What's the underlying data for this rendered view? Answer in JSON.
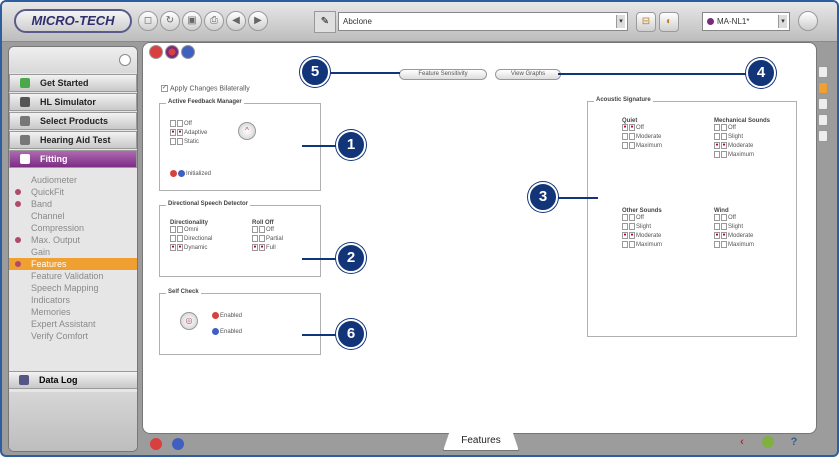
{
  "app": {
    "logo_text": "MICRO-TECH",
    "patient_name": "Abclone",
    "session": "MA-NL1*"
  },
  "sidebar": {
    "nav": [
      {
        "label": "Get Started",
        "icon": "green-check-icon",
        "color": "#4aa84a"
      },
      {
        "label": "HL Simulator",
        "icon": "pencil-icon",
        "color": "#555555"
      },
      {
        "label": "Select Products",
        "icon": "products-icon",
        "color": "#777777"
      },
      {
        "label": "Hearing Aid Test",
        "icon": "test-icon",
        "color": "#777777"
      },
      {
        "label": "Fitting",
        "icon": "fitting-icon",
        "color": "#ffffff"
      }
    ],
    "sub_items": [
      {
        "label": "Audiometer",
        "bullet": false
      },
      {
        "label": "QuickFit",
        "bullet": true
      },
      {
        "label": "Band",
        "bullet": true
      },
      {
        "label": "Channel",
        "bullet": false
      },
      {
        "label": "Compression",
        "bullet": false
      },
      {
        "label": "Max. Output",
        "bullet": true
      },
      {
        "label": "Gain",
        "bullet": false
      },
      {
        "label": "Features",
        "bullet": true,
        "selected": true
      },
      {
        "label": "Feature Validation",
        "bullet": false
      },
      {
        "label": "Speech Mapping",
        "bullet": false
      },
      {
        "label": "Indicators",
        "bullet": false
      },
      {
        "label": "Memories",
        "bullet": false
      },
      {
        "label": "Expert Assistant",
        "bullet": false
      },
      {
        "label": "Verify Comfort",
        "bullet": false
      }
    ],
    "data_log": "Data Log"
  },
  "main": {
    "feature_sensitivity": "Feature Sensitivity",
    "view_graphs": "View Graphs",
    "apply_bilaterally": "Apply Changes Bilaterally",
    "afm": {
      "title": "Active Feedback Manager",
      "options": [
        "Off",
        "Adaptive",
        "Static"
      ],
      "initialized": "Initialized"
    },
    "dsd": {
      "title": "Directional Speech Detector",
      "directionality_head": "Directionality",
      "directionality": [
        "Omni",
        "Directional",
        "Dynamic"
      ],
      "rolloff_head": "Roll Off",
      "rolloff": [
        "Off",
        "Partial",
        "Full"
      ]
    },
    "self_check": {
      "title": "Self Check",
      "enabled_1": "Enabled",
      "enabled_2": "Enabled"
    },
    "acoustic": {
      "title": "Acoustic Signature",
      "quiet_head": "Quiet",
      "quiet": [
        "Off",
        "Moderate",
        "Maximum"
      ],
      "mechanical_head": "Mechanical Sounds",
      "mechanical": [
        "Off",
        "Slight",
        "Moderate",
        "Maximum"
      ],
      "other_head": "Other Sounds",
      "other": [
        "Off",
        "Slight",
        "Moderate",
        "Maximum"
      ],
      "wind_head": "Wind",
      "wind": [
        "Off",
        "Slight",
        "Moderate",
        "Maximum"
      ]
    },
    "bottom_tab": "Features"
  },
  "callouts": [
    "1",
    "2",
    "3",
    "4",
    "5",
    "6"
  ]
}
